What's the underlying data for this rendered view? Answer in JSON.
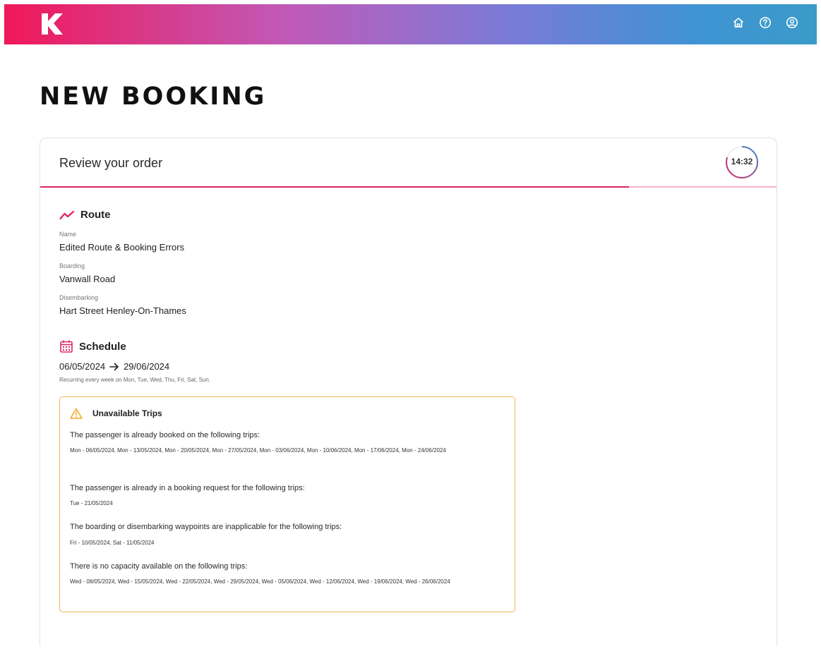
{
  "header": {
    "icons": [
      "k-logo",
      "home-icon",
      "help-icon",
      "account-icon"
    ]
  },
  "page": {
    "title": "NEW BOOKING"
  },
  "card": {
    "title": "Review your order",
    "timer": "14:32",
    "timer_progress": 0.8,
    "step_progress": 0.8
  },
  "route": {
    "heading": "Route",
    "name_label": "Name",
    "name_value": "Edited Route & Booking Errors",
    "boarding_label": "Boarding",
    "boarding_value": "Vanwall Road",
    "disembarking_label": "Disembarking",
    "disembarking_value": "Hart Street Henley-On-Thames"
  },
  "schedule": {
    "heading": "Schedule",
    "start_date": "06/05/2024",
    "end_date": "29/06/2024",
    "recurrence": "Recurring every week on Mon, Tue, Wed, Thu, Fri, Sat, Sun."
  },
  "unavailable": {
    "title": "Unavailable Trips",
    "groups": [
      {
        "heading": "The passenger is already booked on the following trips:",
        "trips": "Mon - 06/05/2024, Mon - 13/05/2024, Mon - 20/05/2024, Mon - 27/05/2024, Mon - 03/06/2024, Mon - 10/06/2024, Mon - 17/06/2024, Mon - 24/06/2024"
      },
      {
        "heading": "The passenger is already in a booking request for the following trips:",
        "trips": "Tue - 21/05/2024"
      },
      {
        "heading": "The boarding or disembarking waypoints are inapplicable for the following trips:",
        "trips": "Fri - 10/05/2024, Sat - 11/05/2024"
      },
      {
        "heading": "There is no capacity available on the following trips:",
        "trips": "Wed - 08/05/2024, Wed - 15/05/2024, Wed - 22/05/2024, Wed - 29/05/2024, Wed - 05/06/2024, Wed - 12/06/2024, Wed - 19/06/2024, Wed - 26/06/2024"
      }
    ]
  },
  "colors": {
    "accent": "#e0246a",
    "warning": "#f5a623"
  }
}
